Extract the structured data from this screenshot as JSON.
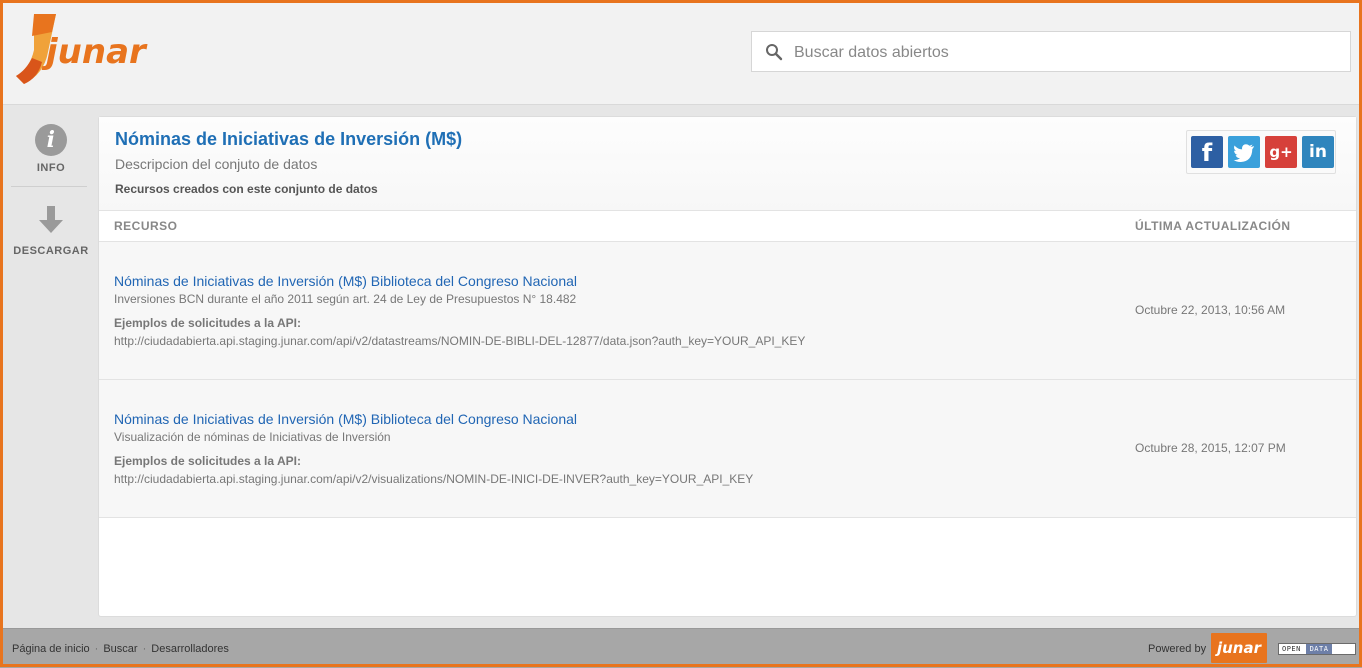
{
  "brand": {
    "name": "junar",
    "accent": "#e8741e"
  },
  "search": {
    "placeholder": "Buscar datos abiertos",
    "icon": "search-icon"
  },
  "sidebar": {
    "items": [
      {
        "label": "INFO",
        "icon": "info-icon"
      },
      {
        "label": "DESCARGAR",
        "icon": "download-arrow-icon"
      }
    ]
  },
  "dataset": {
    "title": "Nóminas de Iniciativas de Inversión (M$)",
    "description": "Descripcion del conjuto de datos",
    "resources_caption": "Recursos creados con este conjunto de datos"
  },
  "share": [
    {
      "name": "facebook",
      "glyph": "f",
      "color": "#2d5fa3"
    },
    {
      "name": "twitter",
      "glyph": "t",
      "color": "#3aa0db"
    },
    {
      "name": "google-plus",
      "glyph": "g+",
      "color": "#d6403a"
    },
    {
      "name": "linkedin",
      "glyph": "in",
      "color": "#2f85bd"
    }
  ],
  "table": {
    "headers": {
      "resource": "RECURSO",
      "updated": "ÚLTIMA ACTUALIZACIÓN"
    },
    "rows": [
      {
        "title": "Nóminas de Iniciativas de Inversión (M$) Biblioteca del Congreso Nacional",
        "subtitle": "Inversiones BCN durante el año 2011 según art. 24 de Ley de Presupuestos N° 18.482",
        "api_label": "Ejemplos de solicitudes a la API:",
        "api_url": "http://ciudadabierta.api.staging.junar.com/api/v2/datastreams/NOMIN-DE-BIBLI-DEL-12877/data.json?auth_key=YOUR_API_KEY",
        "updated": "Octubre 22, 2013, 10:56 AM"
      },
      {
        "title": "Nóminas de Iniciativas de Inversión (M$) Biblioteca del Congreso Nacional",
        "subtitle": "Visualización de nóminas de Iniciativas de Inversión",
        "api_label": "Ejemplos de solicitudes a la API:",
        "api_url": "http://ciudadabierta.api.staging.junar.com/api/v2/visualizations/NOMIN-DE-INICI-DE-INVER?auth_key=YOUR_API_KEY",
        "updated": "Octubre 28, 2015, 12:07 PM"
      }
    ]
  },
  "footer": {
    "links": [
      "Página de inicio",
      "Buscar",
      "Desarrolladores"
    ],
    "powered_by": "Powered by",
    "logo_text": "junar",
    "badge": [
      "OPEN",
      "DATA"
    ]
  }
}
